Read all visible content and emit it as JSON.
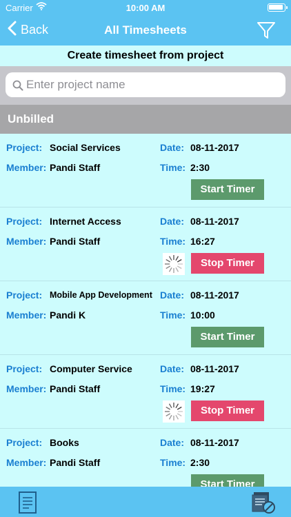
{
  "status_bar": {
    "carrier": "Carrier",
    "time": "10:00 AM"
  },
  "nav": {
    "back_label": "Back",
    "title": "All Timesheets",
    "filter_icon": "filter-icon"
  },
  "create_label": "Create timesheet from project",
  "search": {
    "placeholder": "Enter project name",
    "value": ""
  },
  "section": {
    "title": "Unbilled"
  },
  "labels": {
    "project": "Project:",
    "member": "Member:",
    "date": "Date:",
    "time": "Time:"
  },
  "entries": [
    {
      "project": "Social Services",
      "member": "Pandi Staff",
      "date": "08-11-2017",
      "time": "2:30",
      "button": "Start Timer",
      "running": false
    },
    {
      "project": "Internet Access",
      "member": "Pandi Staff",
      "date": "08-11-2017",
      "time": "16:27",
      "button": "Stop Timer",
      "running": true
    },
    {
      "project": "Mobile App Development",
      "member": "Pandi K",
      "date": "08-11-2017",
      "time": "10:00",
      "button": "Start Timer",
      "running": false
    },
    {
      "project": "Computer Service",
      "member": "Pandi Staff",
      "date": "08-11-2017",
      "time": "19:27",
      "button": "Stop Timer",
      "running": true
    },
    {
      "project": "Books",
      "member": "Pandi Staff",
      "date": "08-11-2017",
      "time": "2:30",
      "button": "Start Timer",
      "running": false
    }
  ],
  "colors": {
    "accent": "#5bc3f2",
    "background": "#cdfcfd",
    "label_blue": "#1a7fd1",
    "start_green": "#5c9a6c",
    "stop_red": "#e4476d",
    "section_gray": "#a6a6a8"
  },
  "bottom_bar": {
    "left_icon": "timesheet-list-icon",
    "right_icon": "unbilled-invoice-icon"
  }
}
